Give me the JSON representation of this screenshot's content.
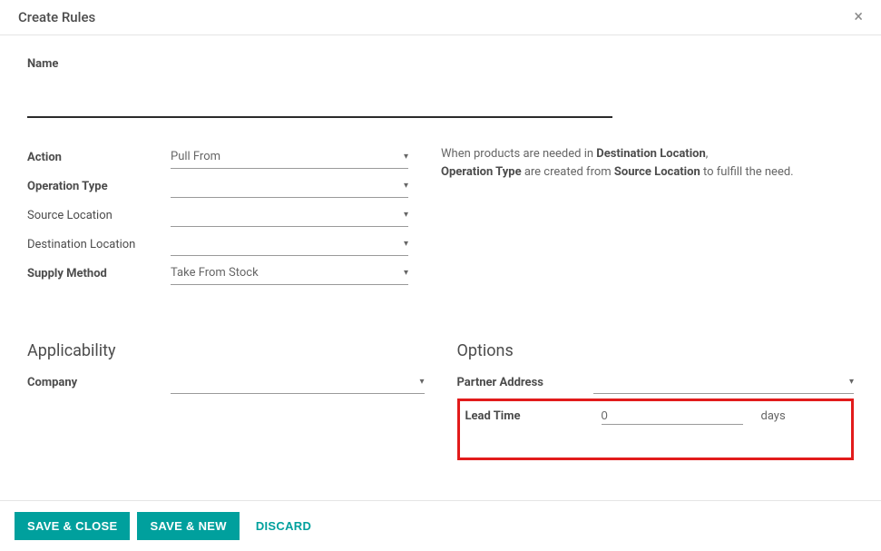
{
  "header": {
    "title": "Create Rules",
    "close": "×"
  },
  "name": {
    "label": "Name",
    "value": ""
  },
  "fields": {
    "action": {
      "label": "Action",
      "value": "Pull From"
    },
    "operation_type": {
      "label": "Operation Type",
      "value": ""
    },
    "source_location": {
      "label": "Source Location",
      "value": ""
    },
    "destination_location": {
      "label": "Destination Location",
      "value": ""
    },
    "supply_method": {
      "label": "Supply Method",
      "value": "Take From Stock"
    }
  },
  "hint": {
    "p1_a": "When products are needed in ",
    "p1_b": "Destination Location",
    "p1_c": ", ",
    "p2_a": "Operation Type",
    "p2_b": " are created from ",
    "p2_c": "Source Location",
    "p2_d": " to fulfill the need."
  },
  "applicability": {
    "title": "Applicability",
    "company": {
      "label": "Company",
      "value": ""
    }
  },
  "options": {
    "title": "Options",
    "partner_address": {
      "label": "Partner Address",
      "value": ""
    },
    "lead_time": {
      "label": "Lead Time",
      "value": "0",
      "unit": "days"
    }
  },
  "footer": {
    "save_close": "Save & Close",
    "save_new": "Save & New",
    "discard": "Discard"
  }
}
